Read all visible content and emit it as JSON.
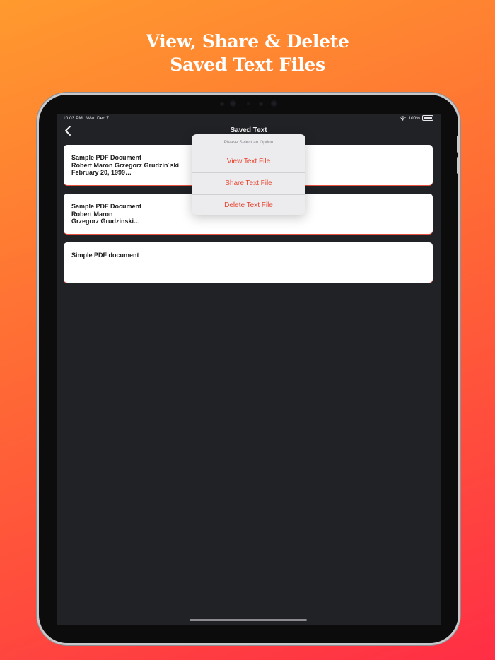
{
  "headline": {
    "line1": "View, Share & Delete",
    "line2": "Saved Text Files"
  },
  "status_bar": {
    "time": "10:03 PM",
    "date": "Wed Dec 7",
    "battery": "100%",
    "wifi_icon": "wifi-icon",
    "battery_icon": "battery-icon"
  },
  "navbar": {
    "title": "Saved Text",
    "back_icon": "chevron-left-icon"
  },
  "files": [
    {
      "lines": [
        "Sample PDF Document",
        "Robert Maron Grzegorz Grudzin´ski",
        "February 20, 1999…"
      ]
    },
    {
      "lines": [
        "Sample PDF Document",
        "Robert Maron",
        "Grzegorz Grudzinski…"
      ]
    },
    {
      "lines": [
        "Simple PDF document"
      ]
    }
  ],
  "popover": {
    "header": "Please Select an Option",
    "options": [
      "View Text File",
      "Share Text File",
      "Delete Text File"
    ]
  },
  "colors": {
    "accent": "#e8452f",
    "screen_bg": "#212226",
    "card_bg": "#ffffff"
  }
}
